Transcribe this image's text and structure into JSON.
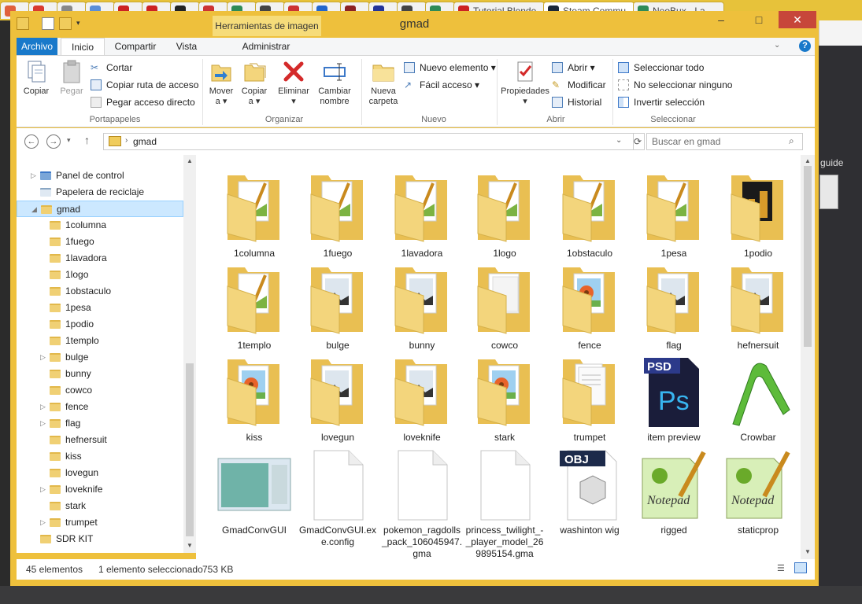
{
  "browser": {
    "tabs": [
      {
        "label": "",
        "color": "#e0603c"
      },
      {
        "label": "",
        "color": "#d93a30"
      },
      {
        "label": "",
        "color": "#888888"
      },
      {
        "label": "",
        "color": "#5a8ed8"
      },
      {
        "label": "",
        "color": "#cc2222"
      },
      {
        "label": "",
        "color": "#cc2222"
      },
      {
        "label": "",
        "color": "#222222"
      },
      {
        "label": "",
        "color": "#cc3333"
      },
      {
        "label": "",
        "color": "#2e8b57"
      },
      {
        "label": "",
        "color": "#444444"
      },
      {
        "label": "",
        "color": "#cc3333"
      },
      {
        "label": "",
        "color": "#2266cc"
      },
      {
        "label": "",
        "color": "#8b2222"
      },
      {
        "label": "",
        "color": "#223399"
      },
      {
        "label": "",
        "color": "#444444"
      },
      {
        "label": "",
        "color": "#2e8b57"
      },
      {
        "label": "Tutorial Blende",
        "color": "#cc2222"
      },
      {
        "label": "Steam Commu",
        "color": "#1b2838"
      },
      {
        "label": "NeoBux - La",
        "color": "#2e8b57"
      }
    ],
    "side_text": "guide"
  },
  "window": {
    "title": "gmad",
    "context_tab": "Herramientas de imagen",
    "controls": {
      "minimize": "–",
      "maximize": "□",
      "close": "✕"
    }
  },
  "ribbon_tabs": [
    "Archivo",
    "Inicio",
    "Compartir",
    "Vista",
    "Administrar"
  ],
  "ribbon": {
    "portapapeles": {
      "label": "Portapapeles",
      "copiar": "Copiar",
      "pegar": "Pegar",
      "cortar": "Cortar",
      "copiar_ruta": "Copiar ruta de acceso",
      "pegar_acceso": "Pegar acceso directo"
    },
    "organizar": {
      "label": "Organizar",
      "mover": "Mover",
      "mover2": "a ▾",
      "copiar": "Copiar",
      "copiar2": "a ▾",
      "eliminar": "Eliminar",
      "eliminar2": "▾",
      "cambiar": "Cambiar",
      "cambiar2": "nombre"
    },
    "nuevo": {
      "label": "Nuevo",
      "nueva": "Nueva",
      "nueva2": "carpeta",
      "nuevo_elemento": "Nuevo elemento ▾",
      "facil_acceso": "Fácil acceso ▾"
    },
    "abrir": {
      "label": "Abrir",
      "propiedades": "Propiedades",
      "propiedades2": "▾",
      "abrir": "Abrir ▾",
      "modificar": "Modificar",
      "historial": "Historial"
    },
    "seleccionar": {
      "label": "Seleccionar",
      "todo": "Seleccionar todo",
      "ninguno": "No seleccionar ninguno",
      "invertir": "Invertir selección"
    }
  },
  "address": {
    "path": "gmad",
    "search_placeholder": "Buscar en gmad"
  },
  "nav_tree": [
    {
      "label": "Panel de control",
      "indent": 1,
      "expander": "▷",
      "type": "sys"
    },
    {
      "label": "Papelera de reciclaje",
      "indent": 1,
      "expander": "",
      "type": "bin"
    },
    {
      "label": "gmad",
      "indent": 1,
      "expander": "◢",
      "type": "folder",
      "selected": true
    },
    {
      "label": "1columna",
      "indent": 2,
      "expander": "",
      "type": "folder"
    },
    {
      "label": "1fuego",
      "indent": 2,
      "expander": "",
      "type": "folder"
    },
    {
      "label": "1lavadora",
      "indent": 2,
      "expander": "",
      "type": "folder"
    },
    {
      "label": "1logo",
      "indent": 2,
      "expander": "",
      "type": "folder"
    },
    {
      "label": "1obstaculo",
      "indent": 2,
      "expander": "",
      "type": "folder"
    },
    {
      "label": "1pesa",
      "indent": 2,
      "expander": "",
      "type": "folder"
    },
    {
      "label": "1podio",
      "indent": 2,
      "expander": "",
      "type": "folder"
    },
    {
      "label": "1templo",
      "indent": 2,
      "expander": "",
      "type": "folder"
    },
    {
      "label": "bulge",
      "indent": 2,
      "expander": "▷",
      "type": "folder"
    },
    {
      "label": "bunny",
      "indent": 2,
      "expander": "",
      "type": "folder"
    },
    {
      "label": "cowco",
      "indent": 2,
      "expander": "",
      "type": "folder"
    },
    {
      "label": "fence",
      "indent": 2,
      "expander": "▷",
      "type": "folder"
    },
    {
      "label": "flag",
      "indent": 2,
      "expander": "▷",
      "type": "folder"
    },
    {
      "label": "hefnersuit",
      "indent": 2,
      "expander": "",
      "type": "folder"
    },
    {
      "label": "kiss",
      "indent": 2,
      "expander": "",
      "type": "folder"
    },
    {
      "label": "lovegun",
      "indent": 2,
      "expander": "",
      "type": "folder"
    },
    {
      "label": "loveknife",
      "indent": 2,
      "expander": "▷",
      "type": "folder"
    },
    {
      "label": "stark",
      "indent": 2,
      "expander": "",
      "type": "folder"
    },
    {
      "label": "trumpet",
      "indent": 2,
      "expander": "▷",
      "type": "folder"
    },
    {
      "label": "SDR KIT",
      "indent": 1,
      "expander": "",
      "type": "folder"
    }
  ],
  "items": [
    {
      "label": "1columna",
      "type": "folder",
      "thumb": "pencil"
    },
    {
      "label": "1fuego",
      "type": "folder",
      "thumb": "pencil"
    },
    {
      "label": "1lavadora",
      "type": "folder",
      "thumb": "pencil"
    },
    {
      "label": "1logo",
      "type": "folder",
      "thumb": "pencil"
    },
    {
      "label": "1obstaculo",
      "type": "folder",
      "thumb": "pencil"
    },
    {
      "label": "1pesa",
      "type": "folder",
      "thumb": "pencil"
    },
    {
      "label": "1podio",
      "type": "folder",
      "thumb": "dark"
    },
    {
      "label": "1templo",
      "type": "folder",
      "thumb": "pencil"
    },
    {
      "label": "bulge",
      "type": "folder",
      "thumb": "photo"
    },
    {
      "label": "bunny",
      "type": "folder",
      "thumb": "photo"
    },
    {
      "label": "cowco",
      "type": "folder",
      "thumb": "blank"
    },
    {
      "label": "fence",
      "type": "folder",
      "thumb": "flower"
    },
    {
      "label": "flag",
      "type": "folder",
      "thumb": "photo"
    },
    {
      "label": "hefnersuit",
      "type": "folder",
      "thumb": "photo"
    },
    {
      "label": "kiss",
      "type": "folder",
      "thumb": "flower"
    },
    {
      "label": "lovegun",
      "type": "folder",
      "thumb": "photo"
    },
    {
      "label": "loveknife",
      "type": "folder",
      "thumb": "photo"
    },
    {
      "label": "stark",
      "type": "folder",
      "thumb": "flower"
    },
    {
      "label": "trumpet",
      "type": "folder",
      "thumb": "docs"
    },
    {
      "label": "item preview",
      "type": "psd"
    },
    {
      "label": "Crowbar",
      "type": "crowbar"
    },
    {
      "label": "GmadConvGUI",
      "type": "app"
    },
    {
      "label": "GmadConvGUI.exe.config",
      "type": "file"
    },
    {
      "label": "pokemon_ragdolls_pack_106045947.gma",
      "type": "file"
    },
    {
      "label": "princess_twilight_-_player_model_269895154.gma",
      "type": "file"
    },
    {
      "label": "washinton wig",
      "type": "obj"
    },
    {
      "label": "rigged",
      "type": "npp"
    },
    {
      "label": "staticprop",
      "type": "npp"
    }
  ],
  "status": {
    "count": "45 elementos",
    "selected": "1 elemento seleccionado",
    "size": "753 KB"
  },
  "colors": {
    "accent": "#1979ca",
    "frame": "#eec03c",
    "folder": "#f3d57c",
    "folder_back": "#e9bf52"
  }
}
